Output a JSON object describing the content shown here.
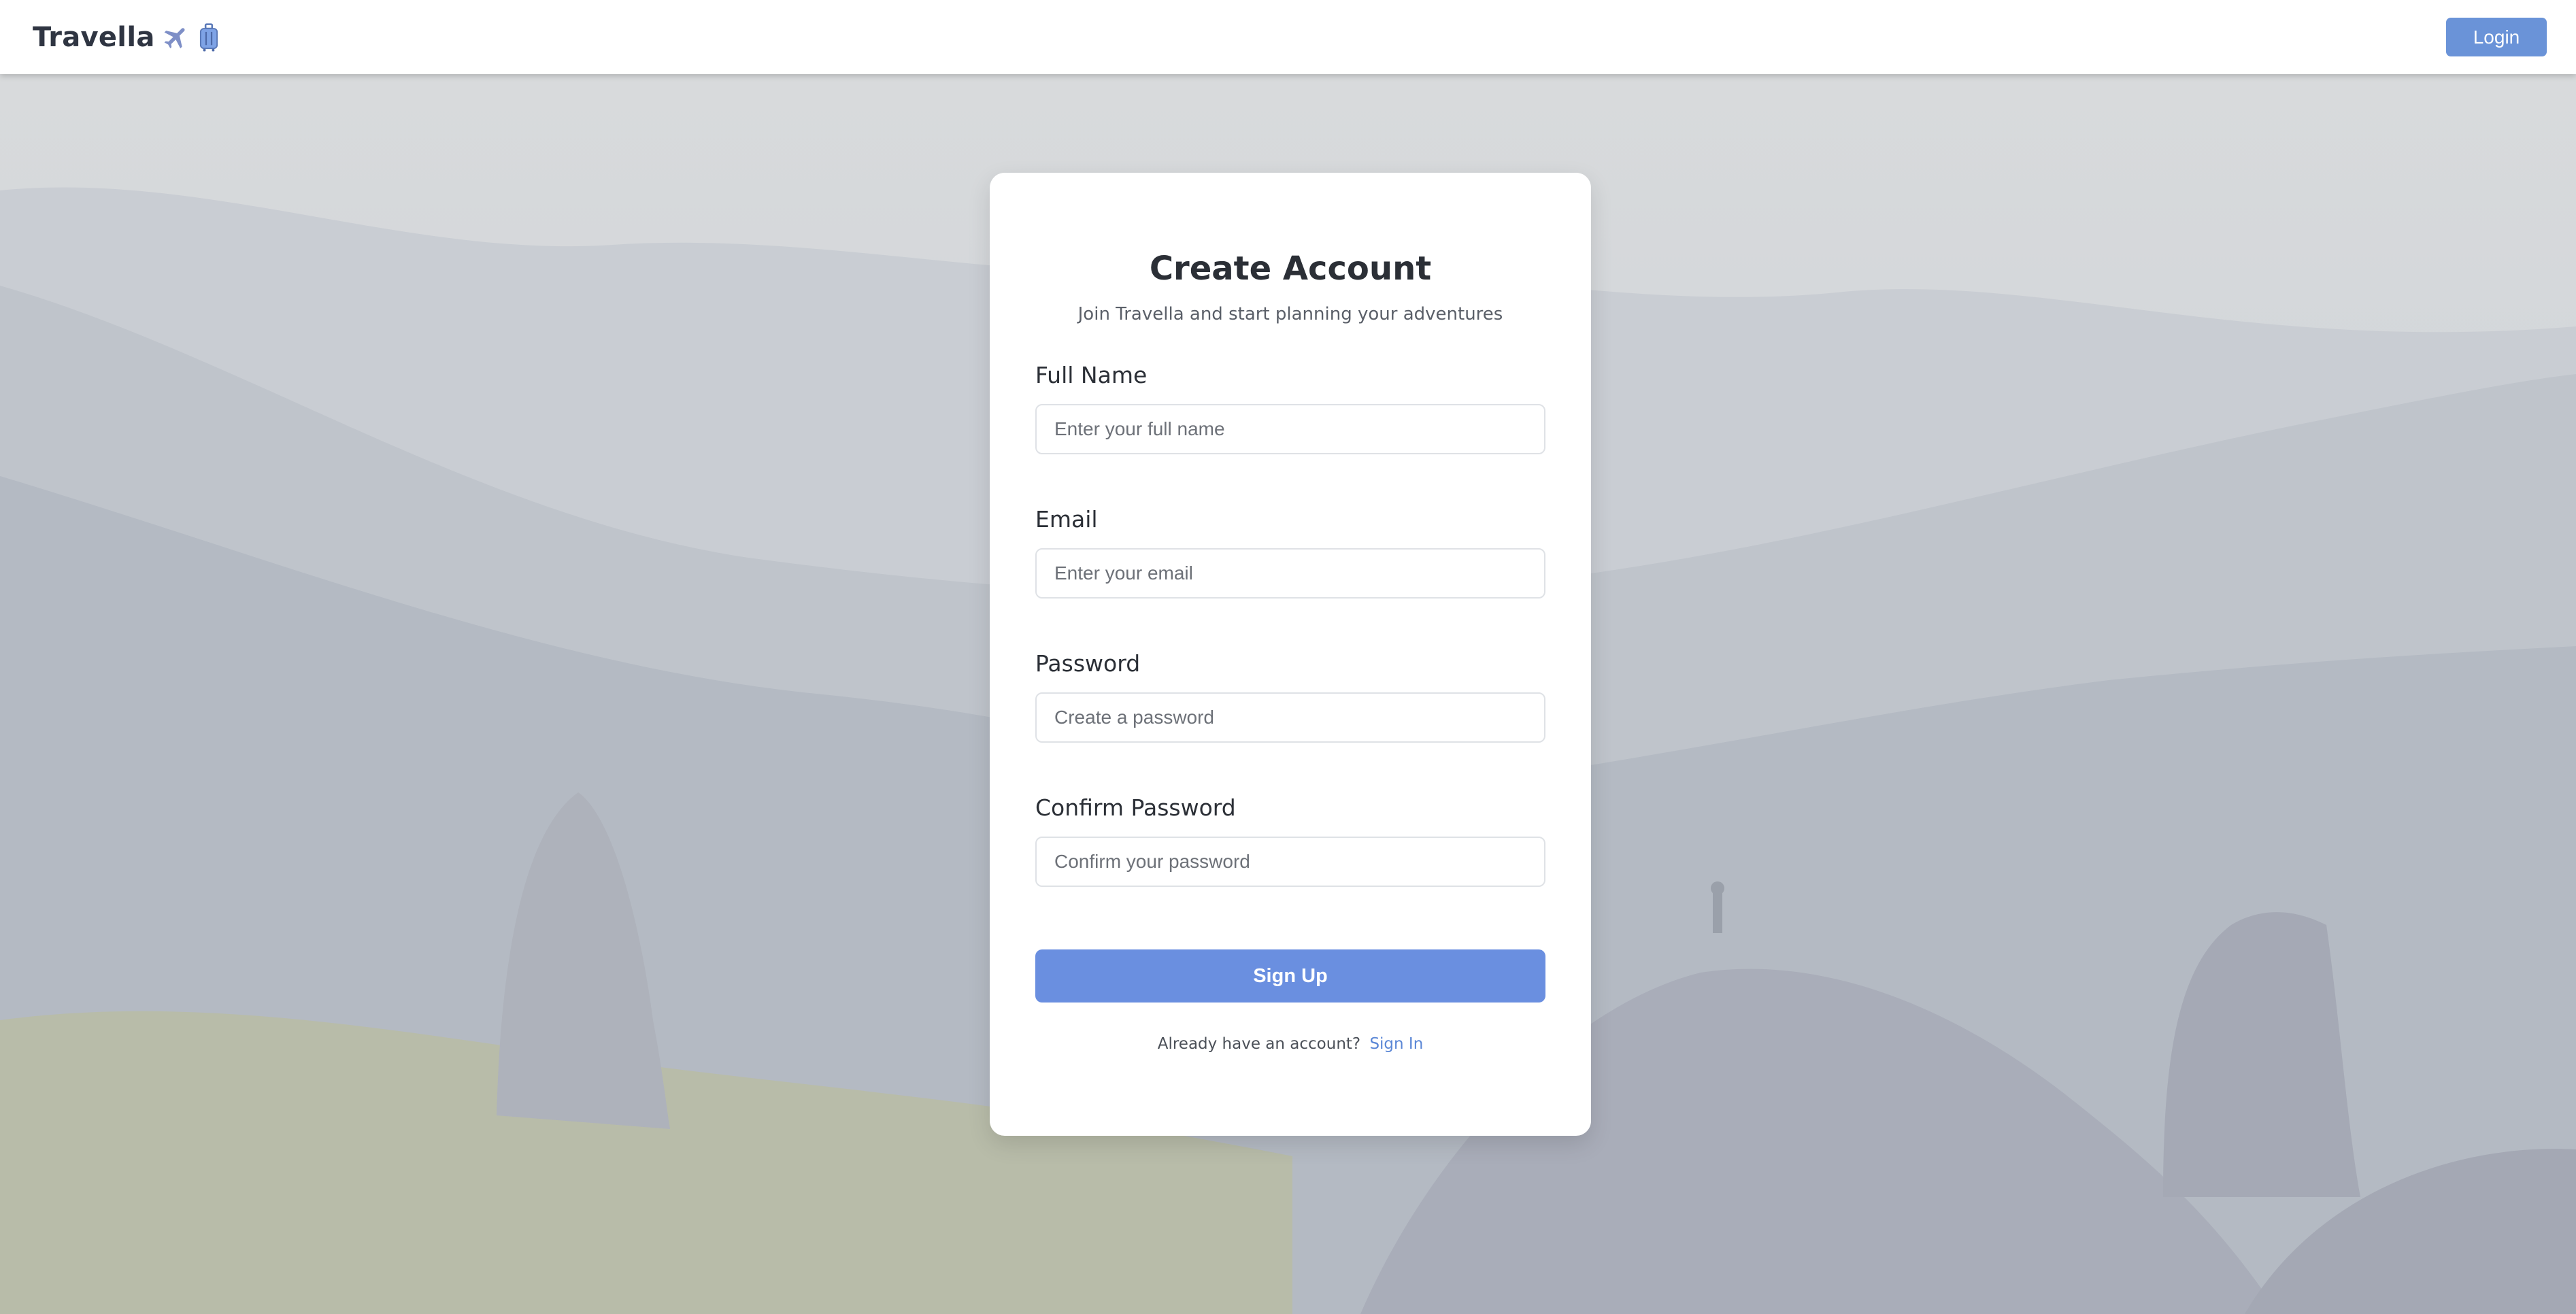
{
  "header": {
    "brand": "Travella",
    "brand_icons": [
      "airplane-icon",
      "luggage-icon"
    ],
    "login_label": "Login"
  },
  "signup": {
    "title": "Create Account",
    "subtitle": "Join Travella and start planning your adventures",
    "fields": [
      {
        "label": "Full Name",
        "placeholder": "Enter your full name",
        "value": ""
      },
      {
        "label": "Email",
        "placeholder": "Enter your email",
        "value": ""
      },
      {
        "label": "Password",
        "placeholder": "Create a password",
        "value": ""
      },
      {
        "label": "Confirm Password",
        "placeholder": "Confirm your password",
        "value": ""
      }
    ],
    "submit_label": "Sign Up",
    "footer_text": "Already have an account?",
    "footer_link": "Sign In"
  },
  "colors": {
    "accent": "#6a93d8",
    "header_bg": "#ffffff",
    "card_bg": "#ffffff",
    "link": "#5b87d6"
  }
}
